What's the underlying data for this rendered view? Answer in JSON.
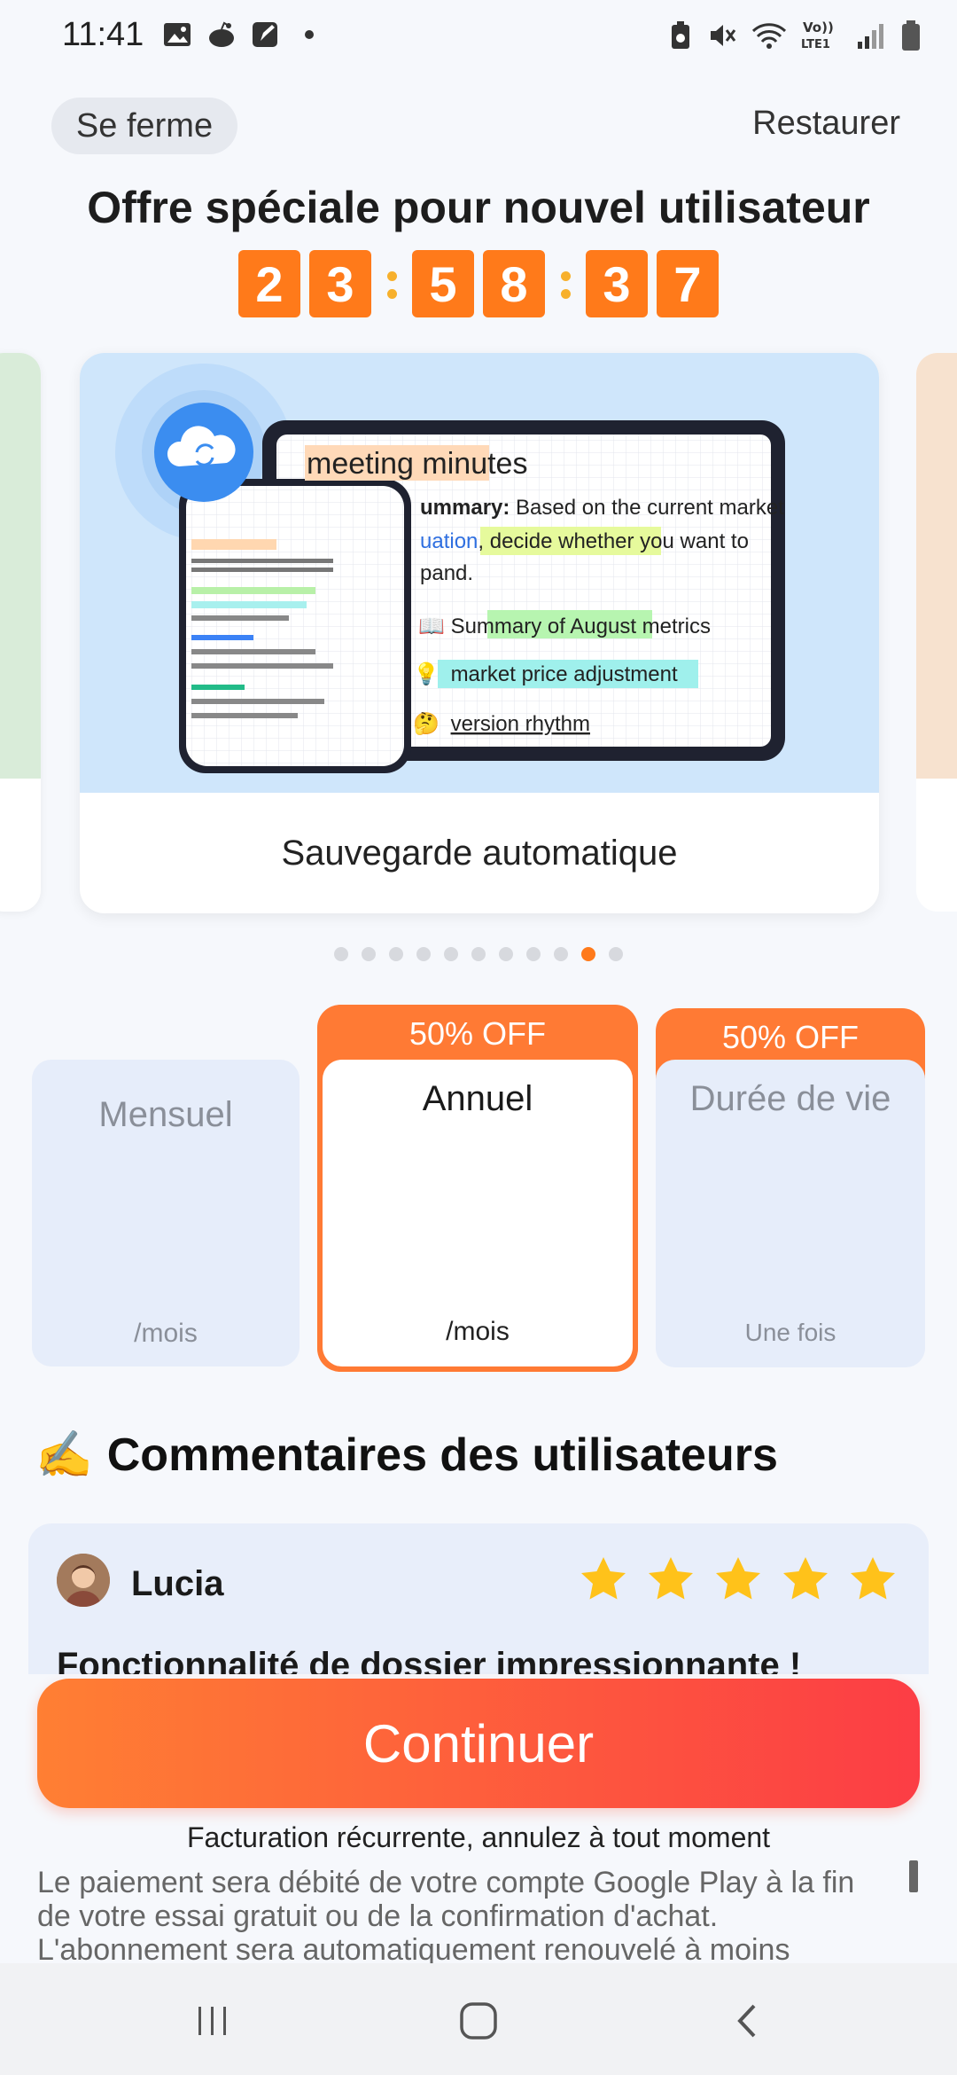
{
  "status_bar": {
    "time": "11:41"
  },
  "header": {
    "close_label": "Se ferme",
    "restore_label": "Restaurer"
  },
  "offer": {
    "title": "Offre spéciale pour nouvel utilisateur",
    "countdown": [
      "2",
      "3",
      "5",
      "8",
      "3",
      "7"
    ]
  },
  "carousel": {
    "caption": "Sauvegarde automatique",
    "image_texts": {
      "heading": "meeting minutes",
      "line1_bold": "ummary:",
      "line1": " Based on the current market",
      "line2_blue": "uation",
      "line2": ", decide ",
      "line2_hl": "whether you want to",
      "line3": "pand.",
      "item1": "Summary of ",
      "item1_hl": "August metrics",
      "item2_hl": "market price adjustment",
      "item3": "version rhythm"
    },
    "page_count": 11,
    "active_page": 9
  },
  "plans": {
    "monthly": {
      "name": "Mensuel",
      "period": "/mois"
    },
    "annual": {
      "badge": "50% OFF",
      "name": "Annuel",
      "period": "/mois"
    },
    "lifetime": {
      "badge": "50% OFF",
      "name": "Durée de vie",
      "period": "Une fois"
    }
  },
  "reviews": {
    "title": "Commentaires des utilisateurs",
    "title_emoji": "✍️",
    "items": [
      {
        "name": "Lucia",
        "rating": 5,
        "headline": "Fonctionnalité de dossier impressionnante !"
      }
    ]
  },
  "cta": {
    "continue_label": "Continuer"
  },
  "footer": {
    "billing": "Facturation récurrente, annulez à tout moment",
    "legal": "Le paiement sera débité de votre compte Google Play à la fin de votre essai gratuit ou de la confirmation d'achat. L'abonnement sera automatiquement renouvelé à moins"
  },
  "colors": {
    "accent": "#ff7a1a",
    "cta_start": "#ff7f33",
    "cta_end": "#fc3d45",
    "star": "#ffc21a"
  }
}
